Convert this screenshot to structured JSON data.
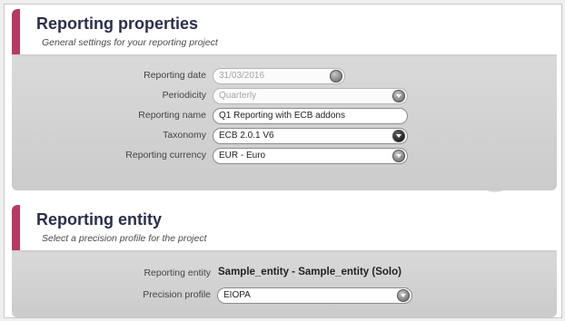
{
  "properties": {
    "title": "Reporting properties",
    "subtitle": "General settings for your reporting project",
    "fields": {
      "reporting_date": {
        "label": "Reporting date",
        "value": "31/03/2016",
        "disabled": true
      },
      "periodicity": {
        "label": "Periodicity",
        "value": "Quarterly",
        "disabled": true
      },
      "reporting_name": {
        "label": "Reporting name",
        "value": "Q1 Reporting with ECB addons"
      },
      "taxonomy": {
        "label": "Taxonomy",
        "value": "ECB 2.0.1 V6"
      },
      "currency": {
        "label": "Reporting currency",
        "value": "EUR - Euro"
      }
    }
  },
  "entity": {
    "title": "Reporting entity",
    "subtitle": "Select a precision profile for the project",
    "fields": {
      "reporting_entity": {
        "label": "Reporting entity",
        "value": "Sample_entity - Sample_entity (Solo)"
      },
      "precision_profile": {
        "label": "Precision profile",
        "value": "EIOPA"
      }
    }
  },
  "colors": {
    "accent": "#b83a63",
    "title": "#2b2f4a"
  },
  "icons": {
    "date_picker": "calendar-knob-icon",
    "dropdown": "chevron-down-icon"
  }
}
